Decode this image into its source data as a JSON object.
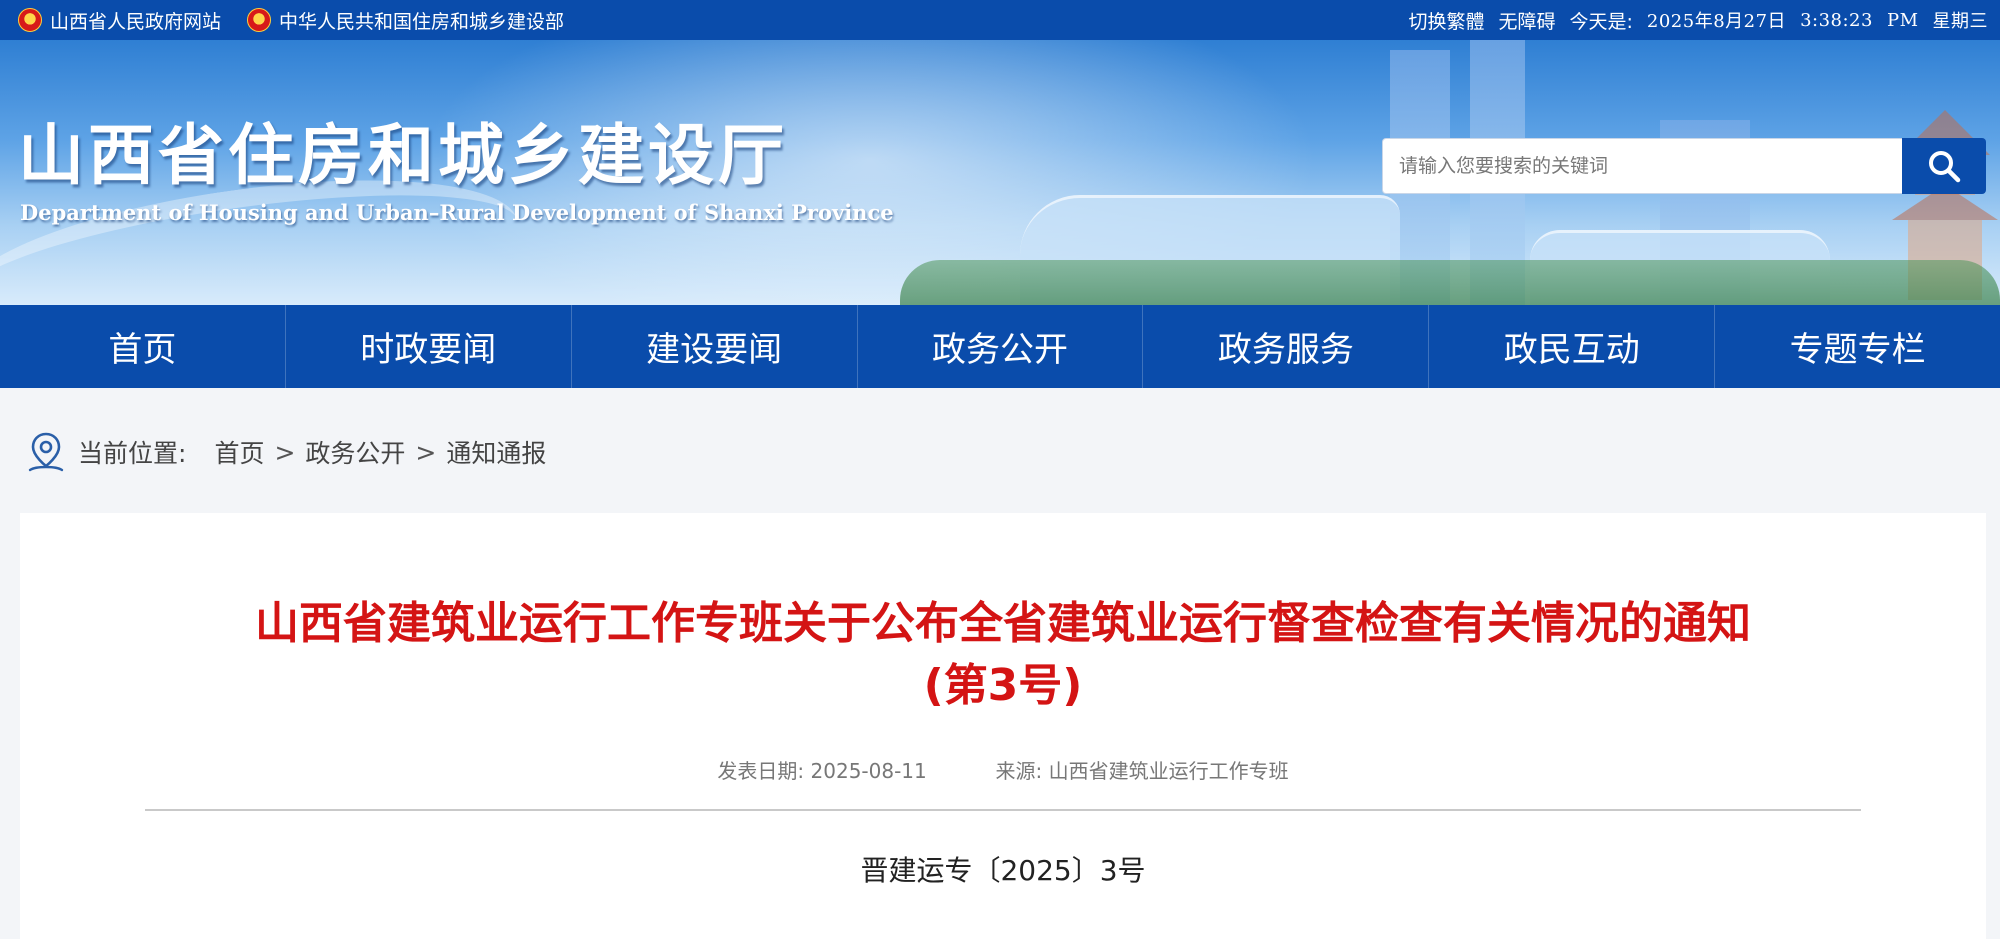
{
  "topbar": {
    "links": [
      "山西省人民政府网站",
      "中华人民共和国住房和城乡建设部"
    ],
    "switch_script": "切换繁體",
    "accessibility": "无障碍",
    "date_prefix": "今天是:",
    "date": "2025年8月27日",
    "time": "3:38:23",
    "ampm": "PM",
    "weekday": "星期三",
    "colors": {
      "bar": "#0a4cab",
      "emblem": "#d71919"
    }
  },
  "header": {
    "title": "山西省住房和城乡建设厅",
    "subtitle": "Department of Housing and Urban–Rural Development of Shanxi Province"
  },
  "search": {
    "placeholder": "请输入您要搜索的关键词",
    "value": "",
    "button_icon": "search-icon"
  },
  "nav": {
    "items": [
      "首页",
      "时政要闻",
      "建设要闻",
      "政务公开",
      "政务服务",
      "政民互动",
      "专题专栏"
    ]
  },
  "breadcrumb": {
    "icon": "location-pin-icon",
    "label": "当前位置:",
    "items": [
      "首页",
      "政务公开",
      "通知通报"
    ],
    "separator": ">"
  },
  "article": {
    "title_line1": "山西省建筑业运行工作专班关于公布全省建筑业运行督查检查有关情况的通知",
    "title_line2": "(第3号)",
    "publish_label": "发表日期:",
    "publish_date": "2025-08-11",
    "source_label": "来源:",
    "source": "山西省建筑业运行工作专班",
    "doc_number": "晋建运专〔2025〕3号",
    "title_color": "#d41414"
  }
}
